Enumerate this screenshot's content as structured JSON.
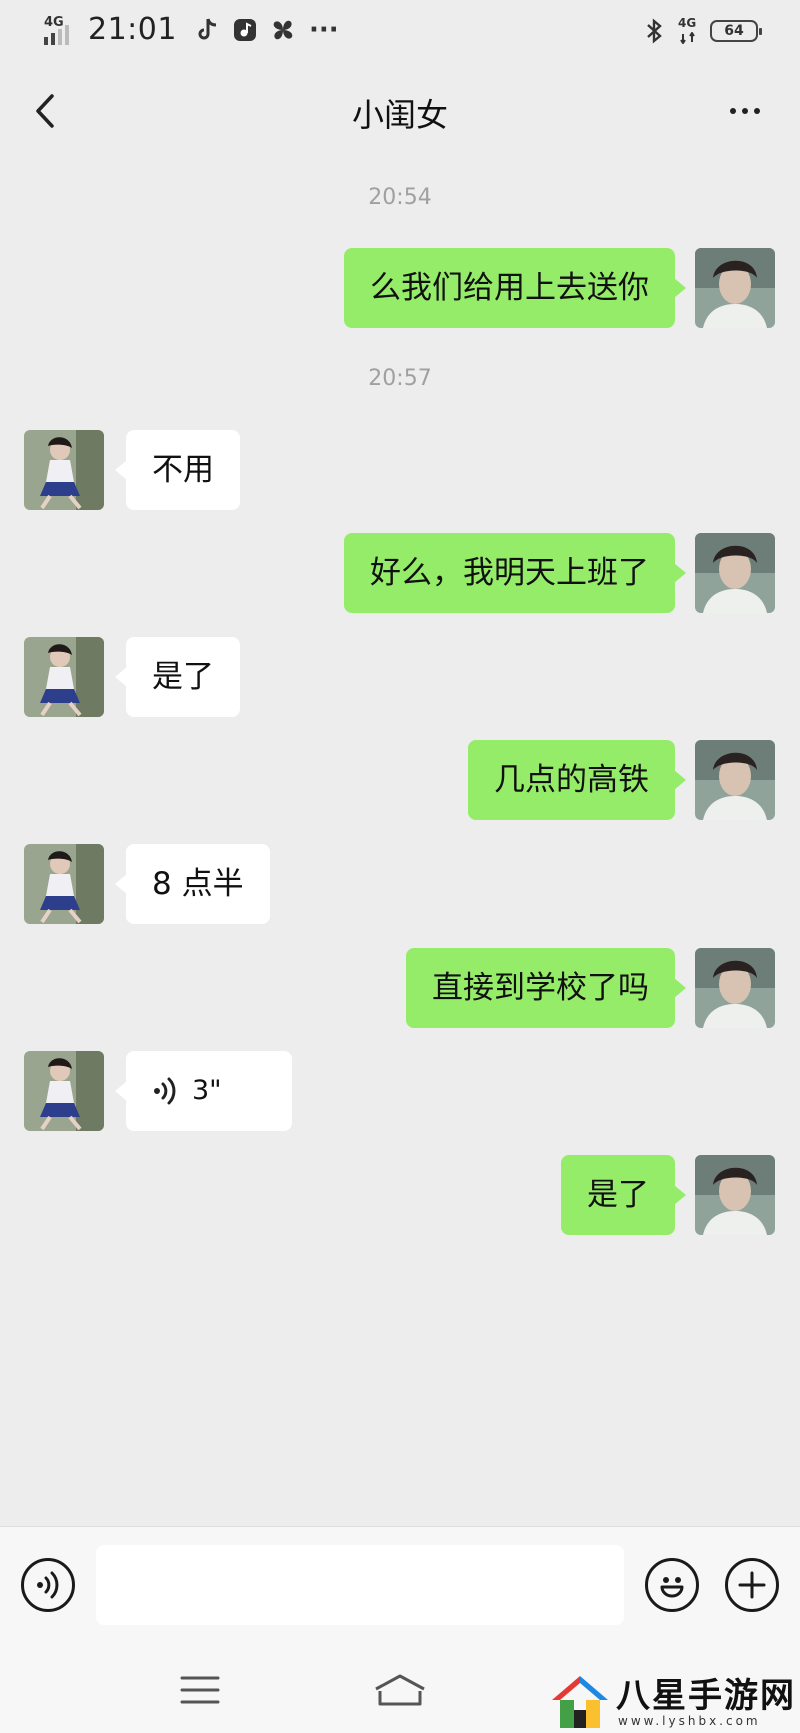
{
  "status_bar": {
    "network_left": "4G",
    "time": "21:01",
    "network_right": "4G",
    "battery": "64",
    "icons": [
      "tiktok-icon",
      "music-app-icon",
      "pinwheel-icon",
      "more-icon",
      "bluetooth-icon"
    ]
  },
  "header": {
    "title": "小闺女",
    "back_icon": "chevron-left-icon",
    "menu_icon": "more-icon"
  },
  "messages": {
    "ts1": "20:54",
    "m1": "么我们给用上去送你",
    "ts2": "20:57",
    "m2": "不用",
    "m3": "好么，我明天上班了",
    "m4": "是了",
    "m5": "几点的高铁",
    "m6": "8 点半",
    "m7": "直接到学校了吗",
    "m8_voice_duration": "3\"",
    "m9": "是了"
  },
  "input_bar": {
    "voice_icon": "voice-icon",
    "emoji_icon": "emoji-icon",
    "add_icon": "plus-icon",
    "placeholder": ""
  },
  "nav_bar": {
    "icons": [
      "menu-icon",
      "home-icon"
    ]
  },
  "watermark": {
    "title": "八星手游网",
    "url": "www.lyshbx.com"
  },
  "colors": {
    "outgoing_bubble": "#95ec69",
    "incoming_bubble": "#ffffff",
    "background": "#ededed"
  }
}
